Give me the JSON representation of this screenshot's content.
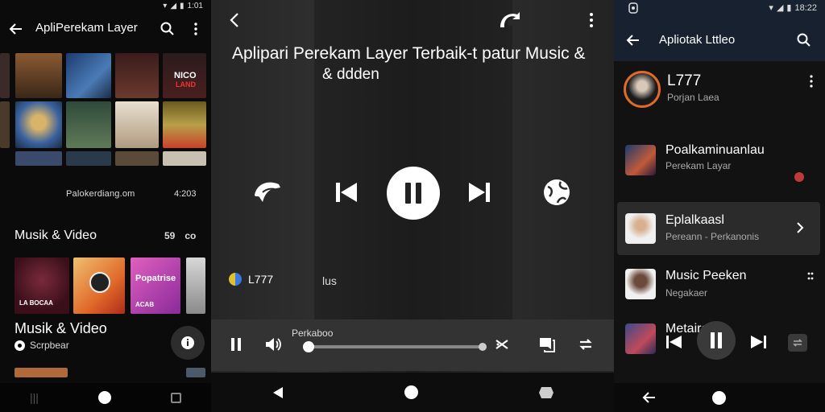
{
  "left": {
    "status_time": "1:01",
    "app_title": "ApliPerekam Layer",
    "ticker_text": "Palokerdiang.om",
    "ticker_count": "4:203",
    "section_title": "Musik & Video",
    "section_icons": [
      "59",
      "co"
    ],
    "poster_captions": [
      "NICO",
      "LAND"
    ],
    "mini_title": "Musik & Video",
    "mini_subtitle": "Scrpbear",
    "video_captions": [
      "LA BOCAA",
      "Popatrise",
      "ACAB"
    ]
  },
  "middle": {
    "headline_line1": "Aplipari Perekam Layer Terbaik-t patur Music &",
    "headline_line2": "& ddden",
    "track_name": "L777",
    "track_right": "lus",
    "progress_label": "Perkaboo",
    "progress_fraction": 0.0
  },
  "right": {
    "status_time": "18:22",
    "title": "Apliotak Lttleo",
    "items": [
      {
        "name": "L777",
        "sub": "Porjan Laea"
      },
      {
        "name": "Poalkaminuanlau",
        "sub": "Perekam Layar"
      },
      {
        "name": "Eplalkaasl",
        "sub": "Pereann - Perkanonis"
      },
      {
        "name": "Music Peeken",
        "sub": "Negakaer"
      },
      {
        "name": "Metairay",
        "sub": ""
      }
    ]
  },
  "colors": {
    "accent_orange": "#e06a2a",
    "panel_dark": "#0b0b0b",
    "right_header": "#182130"
  }
}
